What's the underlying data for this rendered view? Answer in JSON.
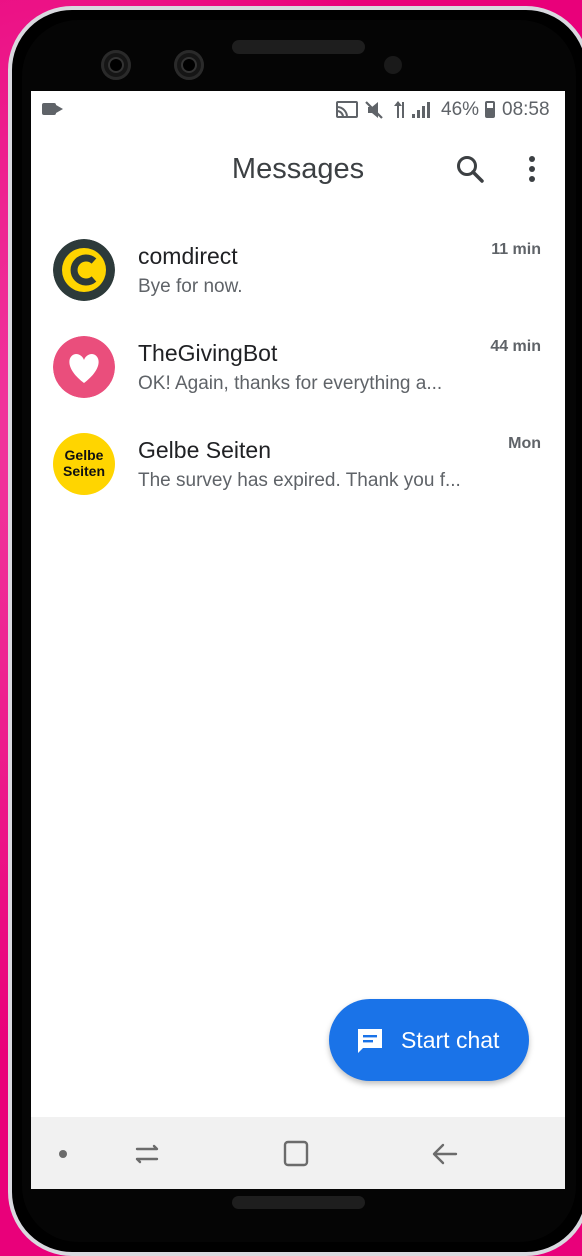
{
  "status_bar": {
    "battery": "46%",
    "time": "08:58",
    "icons": [
      "video-camera-icon",
      "cast-icon",
      "mute-icon",
      "data-arrows-icon",
      "signal-icon",
      "battery-icon"
    ]
  },
  "app_bar": {
    "title": "Messages",
    "icons": [
      "search-icon",
      "more-vert-icon"
    ]
  },
  "conversations": [
    {
      "name": "comdirect",
      "snippet": "Bye for now.",
      "time": "11 min"
    },
    {
      "name": "TheGivingBot",
      "snippet": "OK! Again, thanks for everything a...",
      "time": "44 min"
    },
    {
      "name": "Gelbe Seiten",
      "snippet": "The survey has expired. Thank you f...",
      "time": "Mon",
      "avatar_text": "Gelbe Seiten"
    }
  ],
  "fab": {
    "label": "Start chat",
    "icon": "chat-icon"
  },
  "nav_bar": {
    "icons": [
      "recents-icon",
      "home-icon",
      "back-icon"
    ]
  },
  "colors": {
    "accent": "#1a73e8",
    "background": "#e9007a",
    "comdirect_yellow": "#ffd500",
    "givingbot_pink": "#ea4e7c"
  }
}
